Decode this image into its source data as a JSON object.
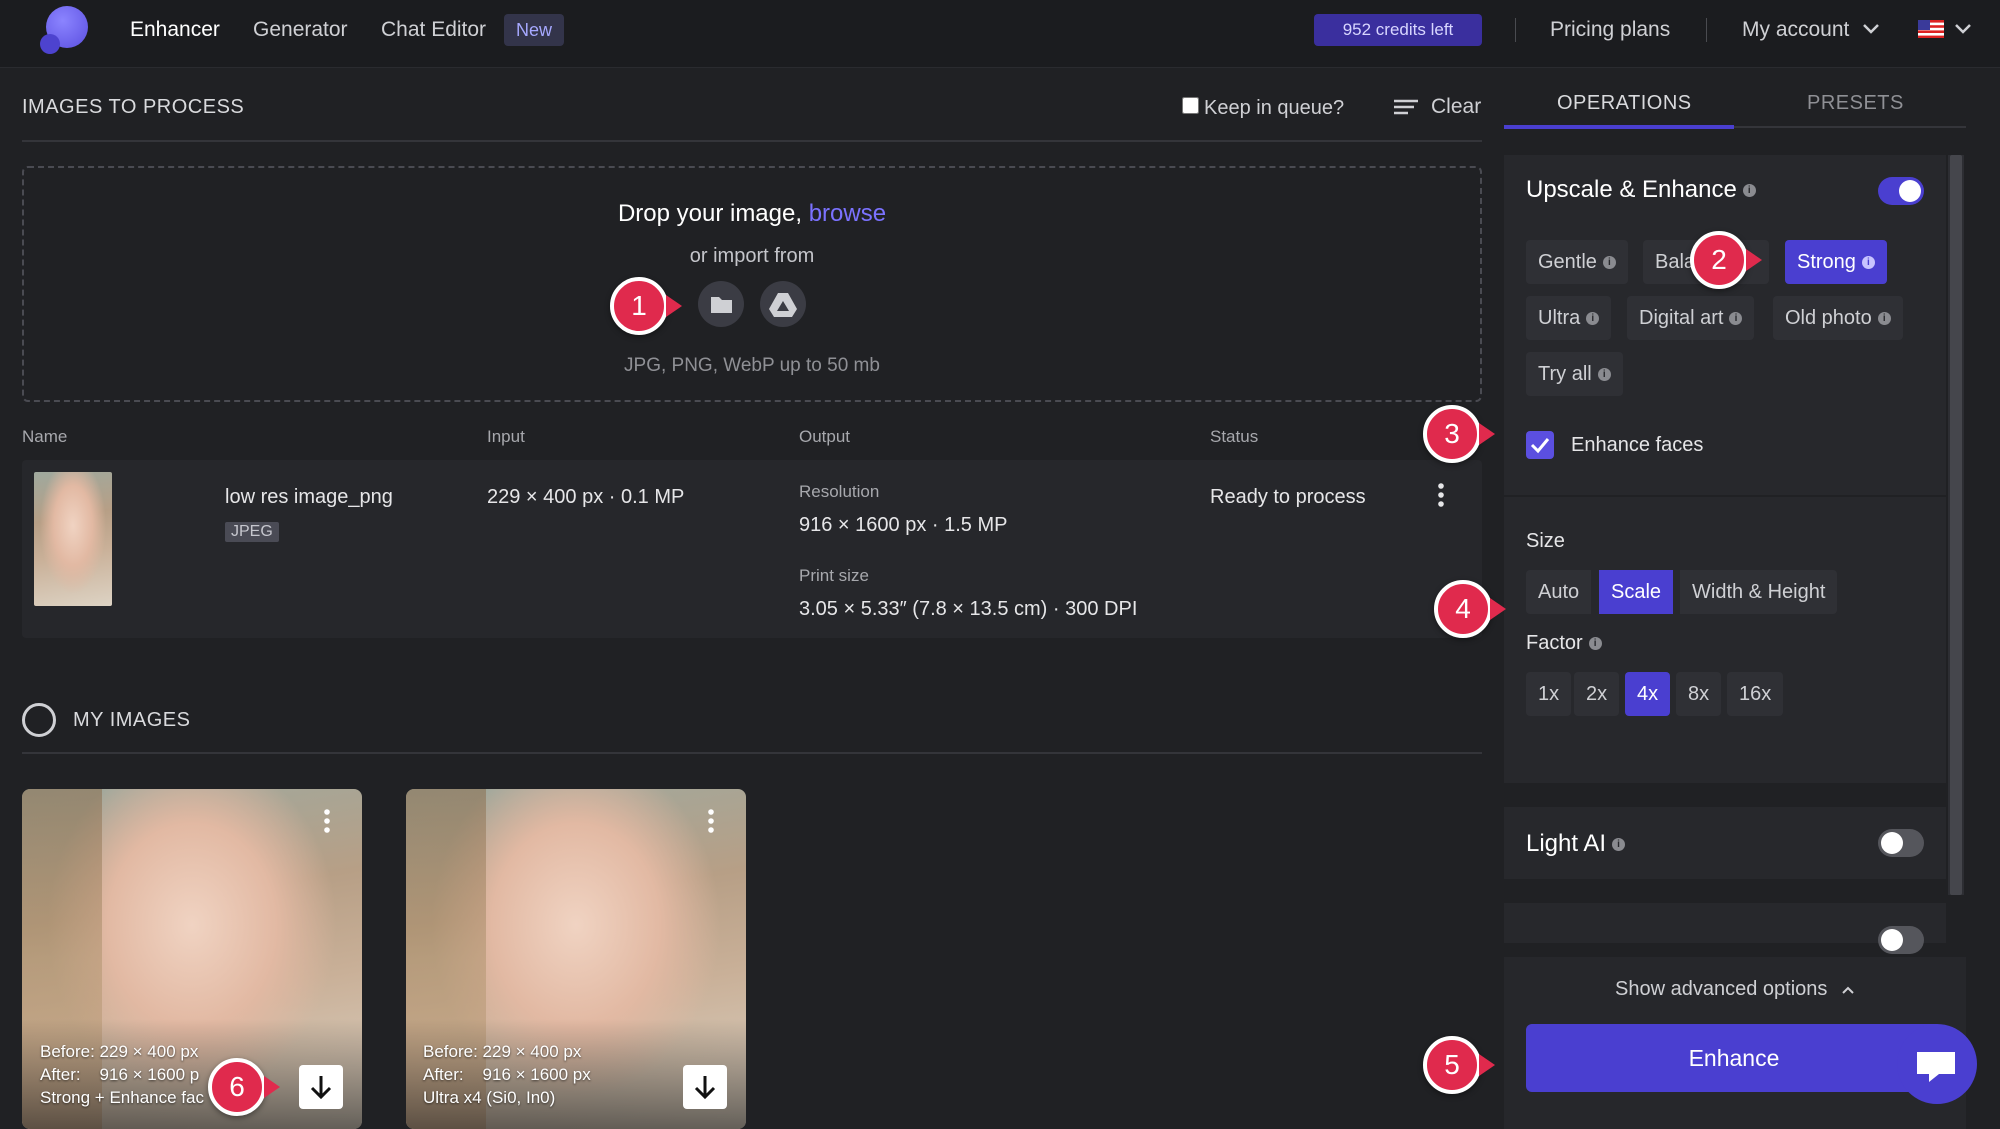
{
  "nav": {
    "items": [
      "Enhancer",
      "Generator",
      "Chat Editor"
    ],
    "new_badge": "New",
    "credits": "952 credits left",
    "pricing": "Pricing plans",
    "account": "My account"
  },
  "queue": {
    "title": "IMAGES TO PROCESS",
    "keep_label": "Keep in queue?",
    "clear_label": "Clear",
    "drop_text": "Drop your image,",
    "browse": "browse",
    "import_text": "or import from",
    "formats": "JPG, PNG, WebP up to 50 mb",
    "columns": [
      "Name",
      "Input",
      "Output",
      "Status"
    ],
    "row": {
      "name": "low res image_png",
      "format": "JPEG",
      "input": "229 × 400 px · 0.1 MP",
      "resolution_label": "Resolution",
      "resolution": "916 × 1600 px · 1.5 MP",
      "print_label": "Print size",
      "print_size": "3.05 × 5.33″ (7.8 × 13.5 cm) · 300 DPI",
      "status": "Ready to process"
    }
  },
  "my_images": {
    "title": "MY IMAGES",
    "cards": [
      {
        "before_label": "Before:",
        "before": "229 × 400 px",
        "after_label": "After:",
        "after": "916 × 1600 p",
        "ops": "Strong + Enhance fac"
      },
      {
        "before_label": "Before:",
        "before": "229 × 400 px",
        "after_label": "After:",
        "after": "916 × 1600 px",
        "ops": "Ultra x4 (Si0, In0)"
      }
    ]
  },
  "panel": {
    "tabs": [
      "OPERATIONS",
      "PRESETS"
    ],
    "upscale_title": "Upscale & Enhance",
    "modes": [
      "Gentle",
      "Bala",
      "Strong",
      "Ultra",
      "Digital art",
      "Old photo",
      "Try all"
    ],
    "active_mode": "Strong",
    "enhance_faces": "Enhance faces",
    "size_label": "Size",
    "size_options": [
      "Auto",
      "Scale",
      "Width & Height"
    ],
    "active_size": "Scale",
    "factor_label": "Factor",
    "factors": [
      "1x",
      "2x",
      "4x",
      "8x",
      "16x"
    ],
    "active_factor": "4x",
    "light_ai": "Light AI",
    "advanced": "Show advanced options",
    "enhance_button": "Enhance"
  },
  "callouts": [
    "1",
    "2",
    "3",
    "4",
    "5",
    "6"
  ],
  "colors": {
    "accent": "#4a3fd0",
    "callout": "#e02a4d",
    "link": "#7b72ff"
  }
}
